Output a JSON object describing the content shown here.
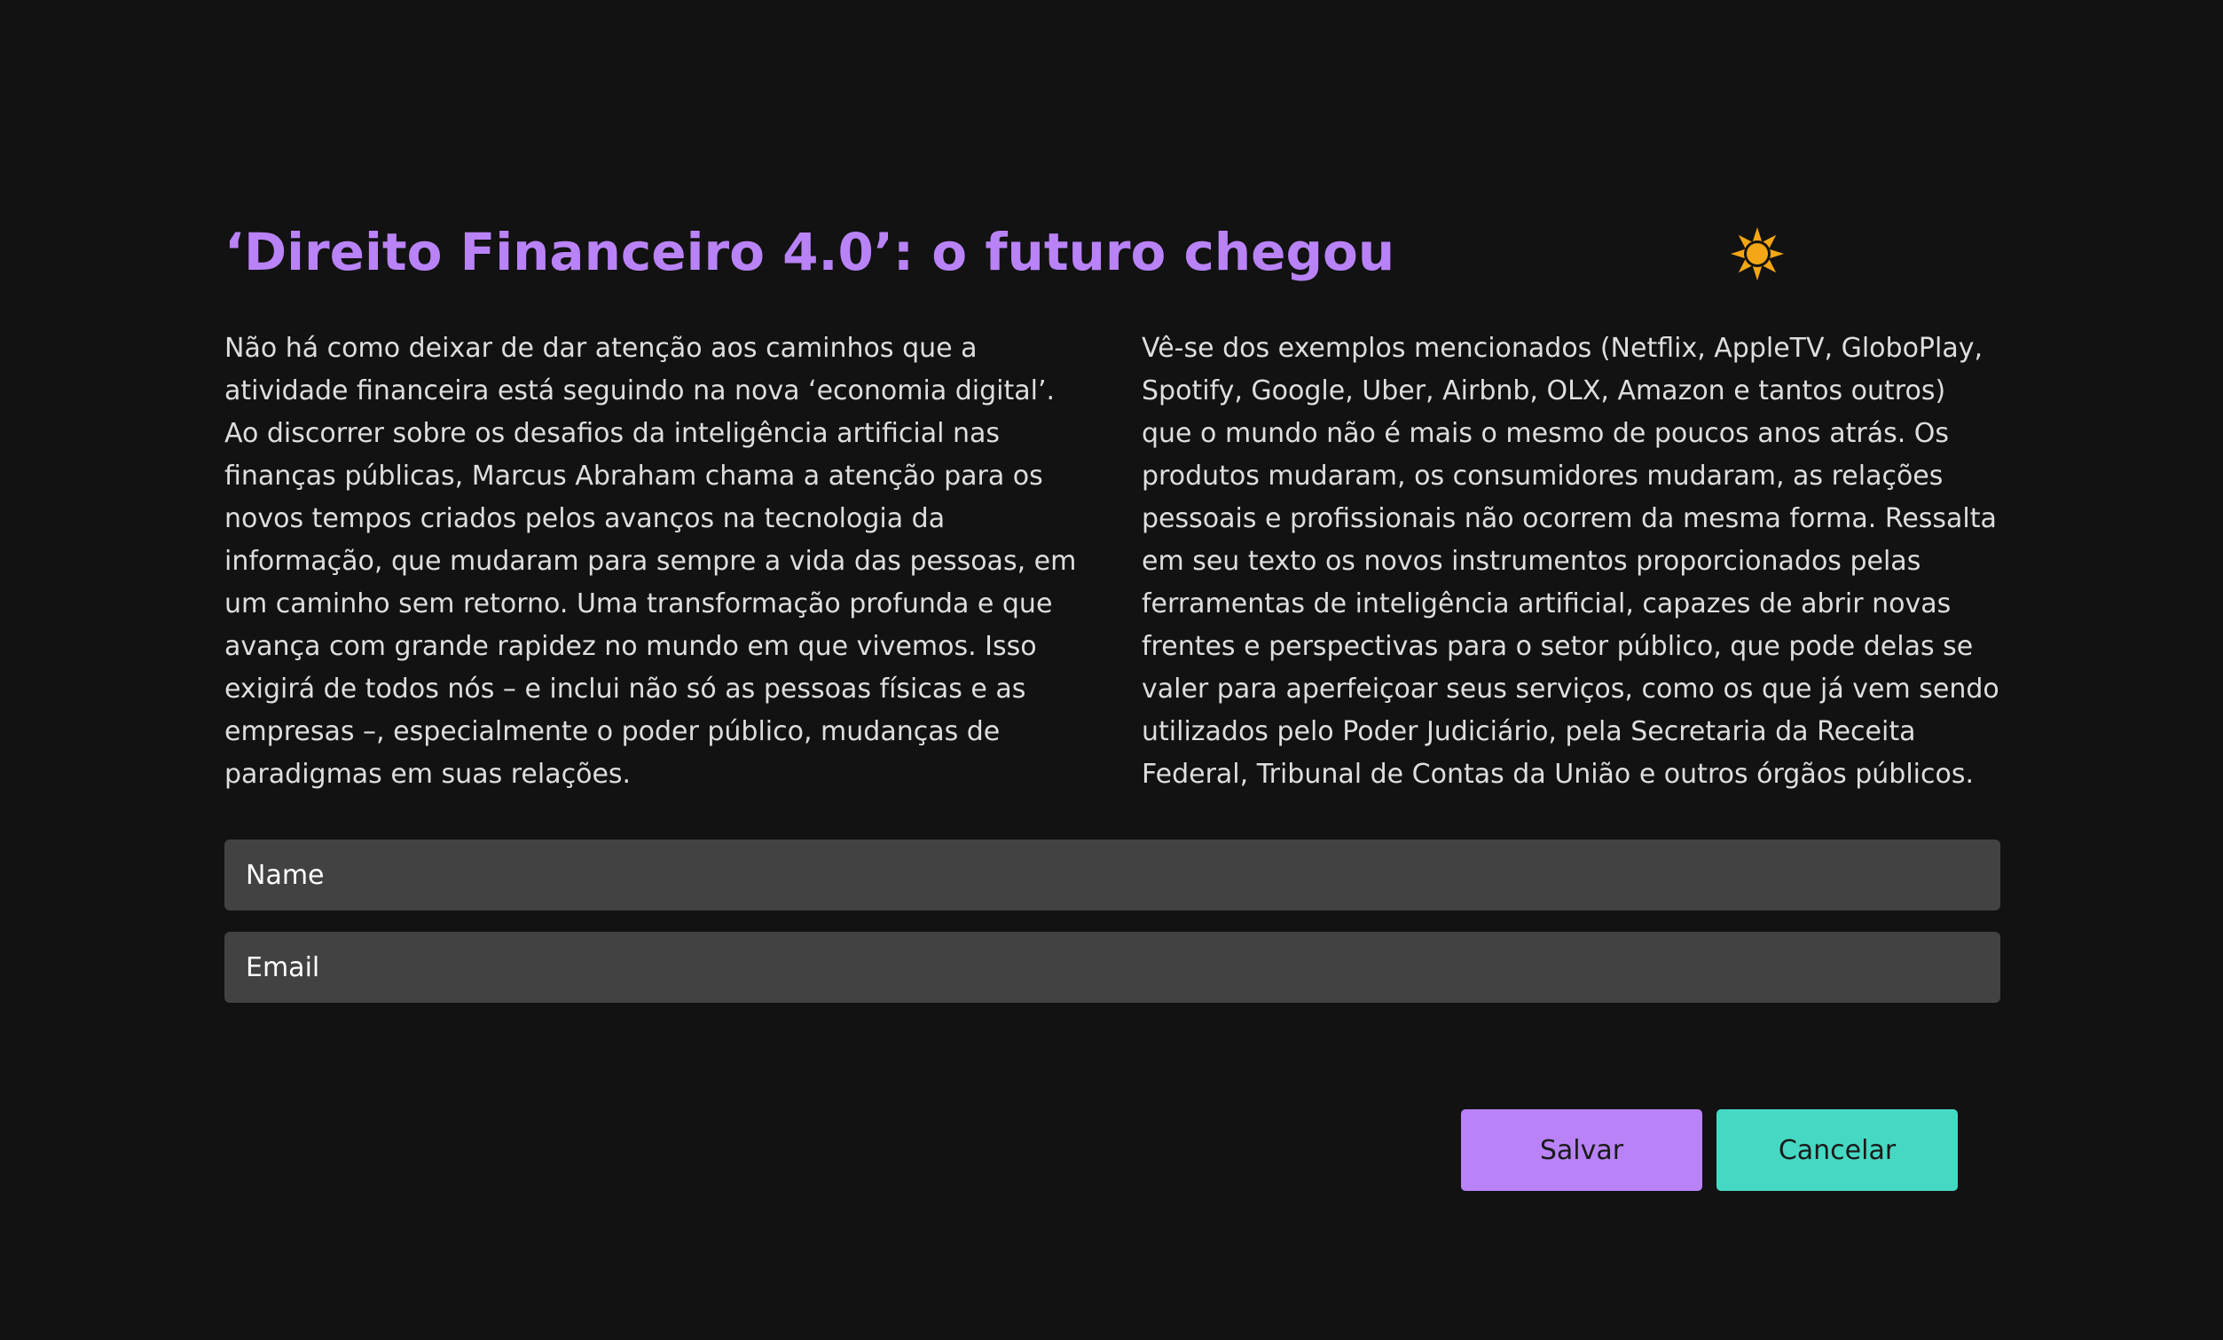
{
  "article": {
    "title": "‘Direito Financeiro 4.0’: o futuro chegou",
    "theme_icon": "sun-icon",
    "left_column": {
      "paragraph_1": "Não há como deixar de dar atenção aos caminhos que a atividade financeira está seguindo na nova ‘economia digital’.",
      "paragraph_2": "Ao discorrer sobre os desafios da inteligência artificial nas finanças públicas, Marcus Abraham chama a atenção para os novos tempos criados pelos avanços na tecnologia da informação, que mudaram para sempre a vida das pessoas, em um caminho sem retorno. Uma transformação profunda e que avança com grande rapidez no mundo em que vivemos. Isso exigirá de todos nós – e inclui não só as pessoas físicas e as empresas –, especialmente o poder público, mudanças de paradigmas em suas relações."
    },
    "right_column": {
      "paragraph_1": "Vê-se dos exemplos mencionados (Netflix, AppleTV, GloboPlay, Spotify, Google, Uber, Airbnb, OLX, Amazon e tantos outros) que o mundo não é mais o mesmo de poucos anos atrás. Os produtos mudaram, os consumidores mudaram, as relações pessoais e profissionais não ocorrem da mesma forma. Ressalta em seu texto os novos instrumentos proporcionados pelas ferramentas de inteligência artificial, capazes de abrir novas frentes e perspectivas para o setor público, que pode delas se valer para aperfeiçoar seus serviços, como os que já vem sendo utilizados pelo Poder Judiciário, pela Secretaria da Receita Federal, Tribunal de Contas da União e outros órgãos públicos."
    }
  },
  "form": {
    "name_placeholder": "Name",
    "name_value": "",
    "email_placeholder": "Email",
    "email_value": "",
    "save_label": "Salvar",
    "cancel_label": "Cancelar"
  },
  "colors": {
    "background": "#121212",
    "accent_purple": "#b983f7",
    "accent_teal": "#45d9c4",
    "field_background": "#424242",
    "body_text": "#dedede",
    "sun_icon": "#f5a614"
  }
}
